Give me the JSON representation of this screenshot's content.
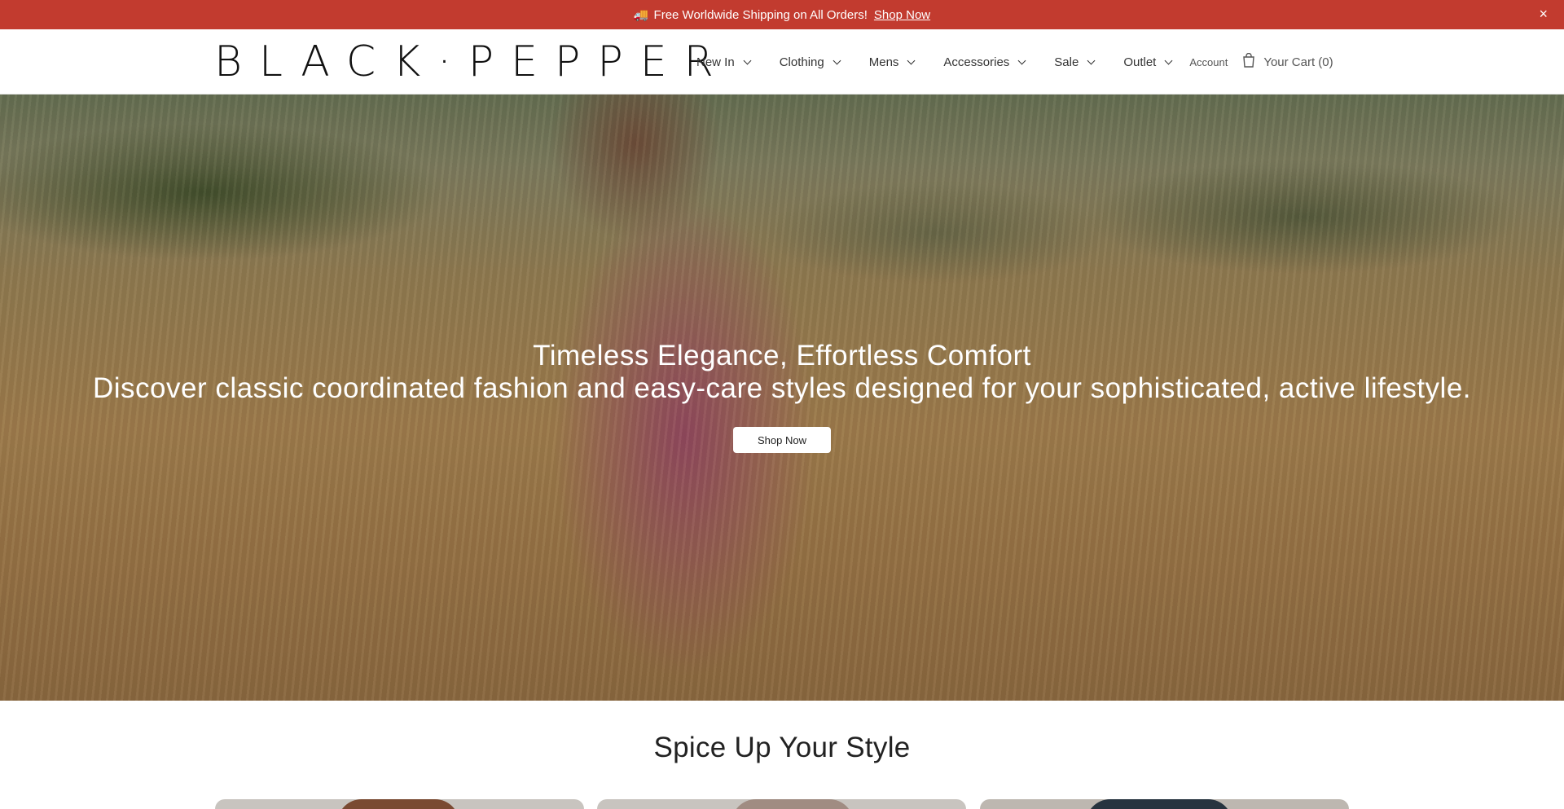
{
  "announcement": {
    "icon": "truck-icon",
    "truck_glyph": "🚚",
    "text": "Free Worldwide Shipping on All Orders!",
    "link_label": "Shop Now",
    "close_glyph": "×",
    "background_color": "#c23b2f"
  },
  "header": {
    "logo_text": "BLACK·PEPPER",
    "nav": [
      {
        "label": "New In"
      },
      {
        "label": "Clothing"
      },
      {
        "label": "Mens"
      },
      {
        "label": "Accessories"
      },
      {
        "label": "Sale"
      },
      {
        "label": "Outlet"
      }
    ],
    "account_label": "Account",
    "cart_label": "Your Cart (0)"
  },
  "hero": {
    "title": "Timeless Elegance, Effortless Comfort",
    "subtitle": "Discover classic coordinated fashion and easy-care styles designed for your sophisticated, active lifestyle.",
    "button_label": "Shop Now"
  },
  "collections": {
    "title": "Spice Up Your Style"
  }
}
